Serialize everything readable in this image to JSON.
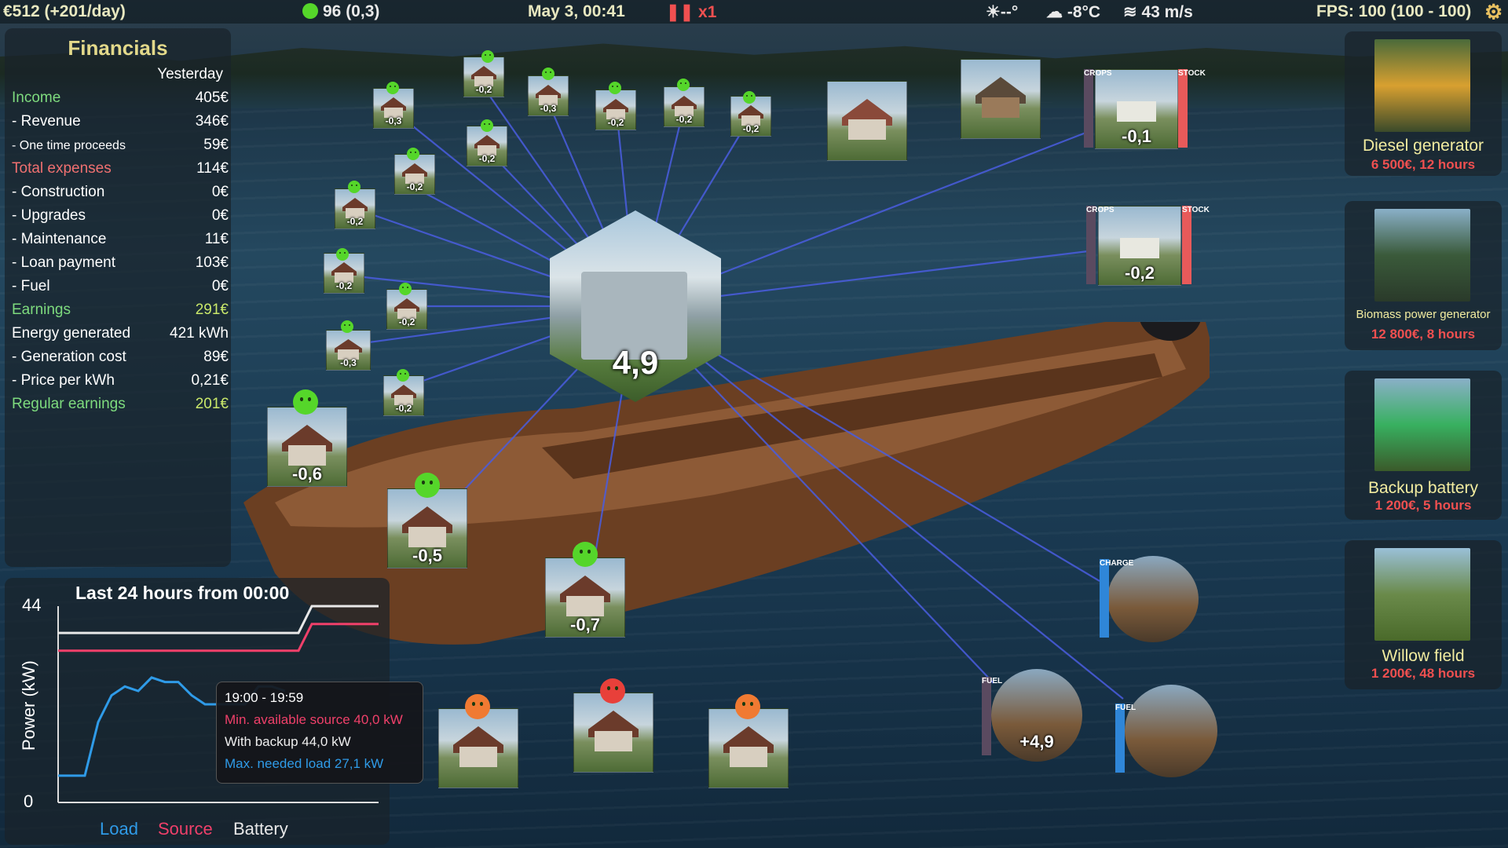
{
  "topbar": {
    "money": "€512 (+201/day)",
    "happiness": "96 (0,3)",
    "datetime": "May 3, 00:41",
    "speed": "x1",
    "sun": "☀--°",
    "temperature": "-8°C",
    "wind": "43 m/s",
    "fps": "FPS: 100 (100 - 100)"
  },
  "financials": {
    "title": "Financials",
    "column": "Yesterday",
    "rows": [
      {
        "label": "Income",
        "value": "405€"
      },
      {
        "label": "- Revenue",
        "value": "346€"
      },
      {
        "label": "- One time proceeds",
        "value": "59€"
      },
      {
        "label": "Total expenses",
        "value": "114€"
      },
      {
        "label": "- Construction",
        "value": "0€"
      },
      {
        "label": "- Upgrades",
        "value": "0€"
      },
      {
        "label": "- Maintenance",
        "value": "11€"
      },
      {
        "label": "- Loan payment",
        "value": "103€"
      },
      {
        "label": "- Fuel",
        "value": "0€"
      },
      {
        "label": "Earnings",
        "value": "291€"
      },
      {
        "label": "Energy generated",
        "value": "421 kWh"
      },
      {
        "label": "- Generation cost",
        "value": "89€"
      },
      {
        "label": "- Price per kWh",
        "value": "0,21€"
      },
      {
        "label": "Regular earnings",
        "value": "201€"
      }
    ]
  },
  "graph": {
    "title": "Last 24 hours from 00:00",
    "ylabel": "Power (kW)",
    "ymax_label": "44",
    "ymin_label": "0",
    "legend": {
      "load": "Load",
      "source": "Source",
      "battery": "Battery"
    },
    "colors": {
      "load": "#2f9be8",
      "source": "#f0406a",
      "battery": "#e8e8e8"
    },
    "tooltip": {
      "time": "19:00 - 19:59",
      "min_source": "Min. available source 40,0 kW",
      "with_backup": "With backup 44,0 kW",
      "max_load": "Max. needed load 27,1 kW"
    }
  },
  "chart_data": {
    "type": "line",
    "x": [
      0,
      1,
      2,
      3,
      4,
      5,
      6,
      7,
      8,
      9,
      10,
      11,
      12,
      13,
      14,
      15,
      16,
      17,
      18,
      19,
      20,
      21,
      22,
      23,
      24
    ],
    "ylim": [
      0,
      44
    ],
    "series": [
      {
        "name": "Load",
        "values": [
          6,
          6,
          6,
          18,
          24,
          26,
          25,
          28,
          27,
          27,
          24,
          22,
          22,
          22,
          22,
          26,
          26,
          25
        ]
      },
      {
        "name": "Source",
        "values": [
          34,
          34,
          34,
          34,
          34,
          34,
          34,
          34,
          34,
          34,
          34,
          34,
          34,
          34,
          34,
          34,
          34,
          34,
          34,
          40,
          40,
          40,
          40,
          40,
          40
        ]
      },
      {
        "name": "Battery",
        "values": [
          38,
          38,
          38,
          38,
          38,
          38,
          38,
          38,
          38,
          38,
          38,
          38,
          38,
          38,
          38,
          38,
          38,
          38,
          38,
          44,
          44,
          44,
          44,
          44,
          44
        ]
      }
    ]
  },
  "hub": {
    "value": "4,9"
  },
  "houses_small": [
    "-0,3",
    "-0,2",
    "-0,3",
    "-0,2",
    "-0,2",
    "-0,2",
    "-0,2",
    "-0,2",
    "-0,2",
    "-0,2",
    "-0,3",
    "-0,2"
  ],
  "houses_large": [
    "-0,6",
    "-0,5",
    "-0,7"
  ],
  "farms": [
    {
      "value": "-0,1",
      "left_tag": "CROPS",
      "right_tag": "STOCK"
    },
    {
      "value": "-0,2",
      "left_tag": "CROPS",
      "right_tag": "STOCK"
    }
  ],
  "charge_station": {
    "tag": "CHARGE"
  },
  "fuel_plant_1": {
    "tag": "FUEL",
    "value": "+4,9"
  },
  "fuel_plant_2": {
    "tag": "FUEL"
  },
  "shop": [
    {
      "name": "Diesel generator",
      "price": "6 500€, 12 hours"
    },
    {
      "name": "Biomass power generator",
      "price": "12 800€, 8 hours"
    },
    {
      "name": "Backup battery",
      "price": "1 200€, 5 hours"
    },
    {
      "name": "Willow field",
      "price": "1 200€, 48 hours"
    }
  ]
}
